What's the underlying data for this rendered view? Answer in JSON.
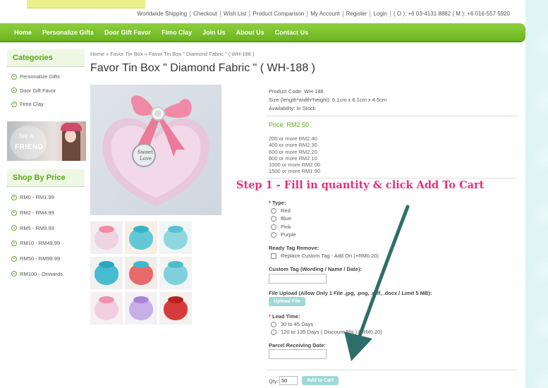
{
  "top_links": [
    "Worldwide Shipping",
    "Checkout",
    "Wish List",
    "Product Comparison",
    "My Account",
    "Register",
    "Login",
    "( O ): +6 03-4131 8882 ( M ): +6 016-557 5920"
  ],
  "nav": [
    "Home",
    "Personalize Gifts",
    "Door Gift Favor",
    "Fimo Clay",
    "Join Us",
    "About Us",
    "Contact Us"
  ],
  "sidebar": {
    "categories_title": "Categories",
    "categories": [
      "Personalize Gifts",
      "Door Gift Favor",
      "Fimo Clay"
    ],
    "tell_a": "Tell A",
    "friend": "FRIEND",
    "shop_title": "Shop By Price",
    "price_ranges": [
      "RM0 - RM1.99",
      "RM2 - RM4.99",
      "RM5 - RM9.99",
      "RM10 - RM49.99",
      "RM50 - RM99.99",
      "RM100 - Onwards"
    ]
  },
  "breadcrumb": "Home » Favor Tin Box » Favor Tin Box \" Diamond Fabric \" ( WH-188 )",
  "product": {
    "title": "Favor Tin Box \" Diamond Fabric \" ( WH-188 )",
    "code": "Product Code: WH-188",
    "size": "Size (length*width*height): 6.1cm x 6.1cm x 4.5cm",
    "availability": "Availability: In Stock",
    "price": "Price: RM2.50",
    "tiers": [
      "200 or more RM2.40",
      "400 or more RM2.30",
      "600 or more RM2.20",
      "800 or more RM2.10",
      "1000 or more RM2.00",
      "1500 or more RM1.90"
    ],
    "tin_text_1": "Sweet",
    "tin_text_2": "Love"
  },
  "annotation": "Step 1 - Fill in quantity & click Add To Cart",
  "options": {
    "type_label": "Type:",
    "types": [
      "Red",
      "Blue",
      "Pink",
      "Purple"
    ],
    "ready_tag_label": "Ready Tag Remove:",
    "ready_tag_option": "Replace Custom Tag - Add On (+RM0.20)",
    "custom_tag_label": "Custom Tag (Wording / Name / Date):",
    "upload_label": "File Upload (Allow Only 1 File .jpg, .png, .pdf, .docx / Limit 5 MB):",
    "upload_button": "Upload File",
    "lead_time_label": "Lead Time:",
    "lead_times": [
      "30 to 45 Days",
      "120 to 135 Days ( Discount 8% ) (-RM0.20)"
    ],
    "parcel_date_label": "Parcel Receiving Date:"
  },
  "qty_label": "Qty:",
  "qty_value": "50",
  "add_to_cart": "Add to Cart",
  "colors": {
    "nav_green": "#6bb420",
    "annotation_pink": "#e5307a",
    "arrow_teal": "#2f6e68",
    "button_teal": "#9fd8d6",
    "price_green": "#5aa81c"
  }
}
